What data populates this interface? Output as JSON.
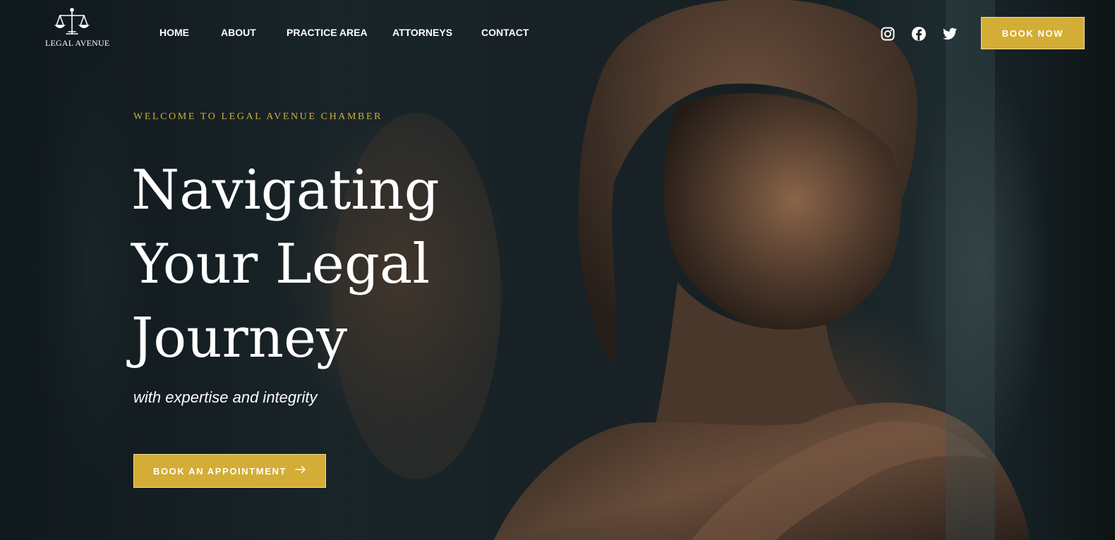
{
  "brand": {
    "logo_text": "LEGAL AVENUE"
  },
  "nav": {
    "items": [
      {
        "label": "HOME"
      },
      {
        "label": "ABOUT"
      },
      {
        "label": "PRACTICE AREA"
      },
      {
        "label": "ATTORNEYS"
      },
      {
        "label": "CONTACT"
      }
    ]
  },
  "social": {
    "icons": [
      "instagram-icon",
      "facebook-icon",
      "twitter-icon"
    ]
  },
  "header": {
    "book_now_label": "BOOK NOW"
  },
  "hero": {
    "eyebrow": "WELCOME TO LEGAL AVENUE CHAMBER",
    "headline_lines": [
      "Navigating",
      "Your Legal",
      "Journey"
    ],
    "subheading": "with expertise and integrity",
    "cta_label": "BOOK AN APPOINTMENT",
    "cta_icon": "arrow-right-icon",
    "background_image": "bronze-statue-photo"
  },
  "colors": {
    "accent": "#d3ad36",
    "accent_border": "#f1dc9d",
    "text": "#ffffff",
    "background": "#121d20"
  }
}
